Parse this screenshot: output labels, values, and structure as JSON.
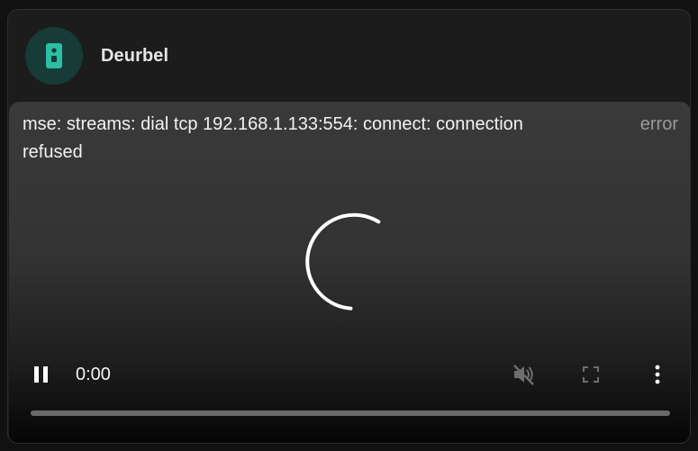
{
  "card": {
    "title": "Deurbel",
    "icon": "doorbell-icon",
    "icon_bg": "#173b36",
    "icon_color": "#2bbfa4"
  },
  "player": {
    "error_message": "mse: streams: dial tcp 192.168.1.133:554: connect: connection refused",
    "error_tag": "error",
    "loading": true,
    "controls": {
      "play_state": "pause-icon",
      "time": "0:00",
      "mute_icon": "volume-off-icon",
      "fullscreen_icon": "fullscreen-icon",
      "more_icon": "more-vertical-icon",
      "progress": 0
    }
  }
}
